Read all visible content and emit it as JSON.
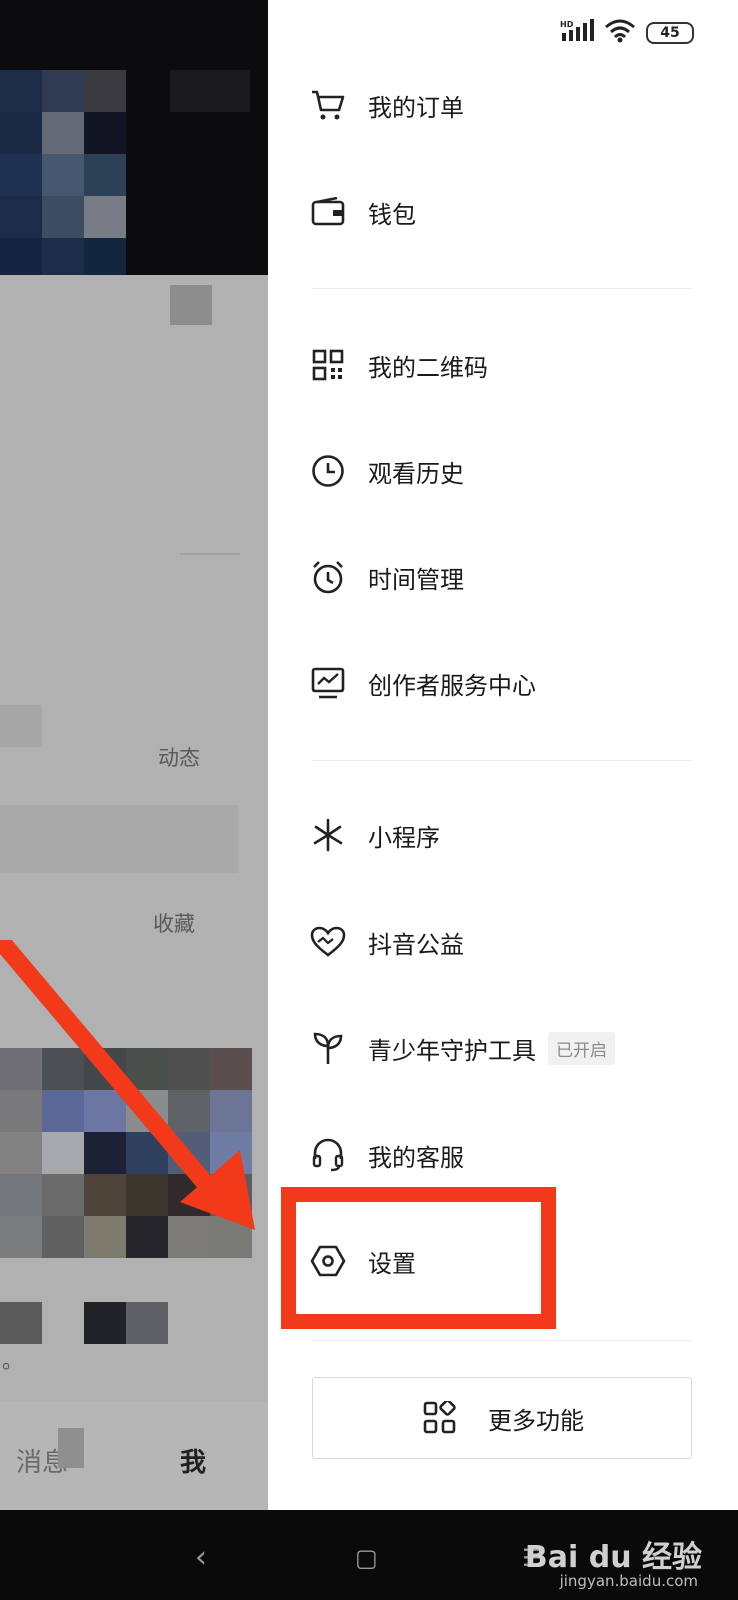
{
  "status_bar": {
    "network": "HD",
    "battery": "45"
  },
  "left_page": {
    "texts": [
      "动态",
      "收藏",
      "。"
    ],
    "nav": {
      "messages": "消息",
      "me": "我"
    }
  },
  "drawer": {
    "items": [
      {
        "label": "我的订单",
        "icon": "cart-icon"
      },
      {
        "label": "钱包",
        "icon": "wallet-icon"
      },
      {
        "label": "我的二维码",
        "icon": "qr-code-icon"
      },
      {
        "label": "观看历史",
        "icon": "clock-icon"
      },
      {
        "label": "时间管理",
        "icon": "alarm-icon"
      },
      {
        "label": "创作者服务中心",
        "icon": "chart-monitor-icon"
      },
      {
        "label": "小程序",
        "icon": "mini-program-icon"
      },
      {
        "label": "抖音公益",
        "icon": "heart-icon"
      },
      {
        "label": "青少年守护工具",
        "icon": "sprout-icon",
        "tag": "已开启"
      },
      {
        "label": "我的客服",
        "icon": "headset-icon"
      },
      {
        "label": "设置",
        "icon": "settings-hexagon-icon"
      }
    ],
    "more_button": {
      "label": "更多功能",
      "icon": "apps-icon"
    }
  },
  "annotation": {
    "highlight_color": "#f2391a"
  },
  "system_nav": {
    "back": "‹",
    "home": "▢",
    "menu": "☰"
  },
  "watermark": {
    "brand": "Bai du 经验",
    "url": "jingyan.baidu.com"
  }
}
